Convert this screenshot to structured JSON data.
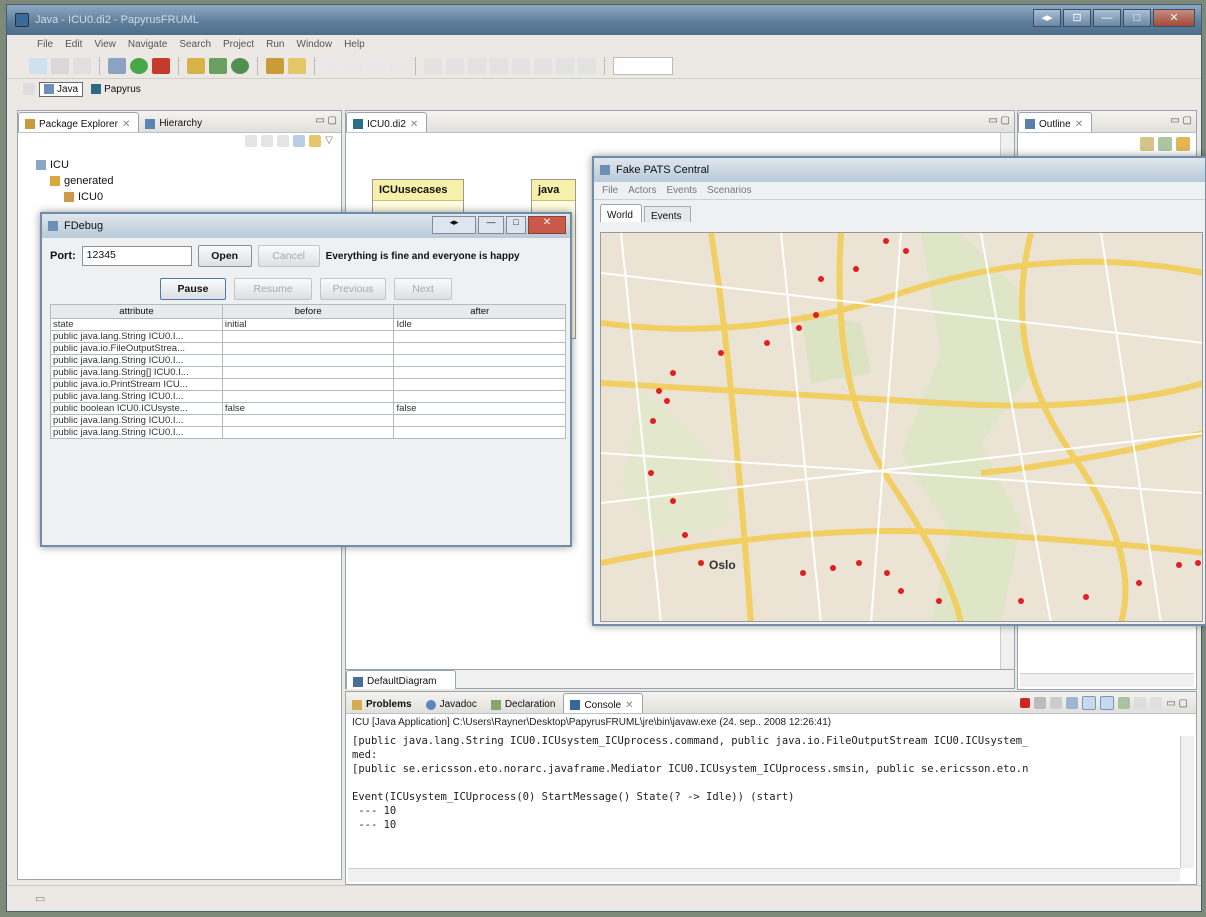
{
  "eclipse": {
    "window_title": "Java - ICU0.di2 - PapyrusFRUML",
    "menu": [
      "File",
      "Edit",
      "View",
      "Navigate",
      "Search",
      "Project",
      "Run",
      "Window",
      "Help"
    ],
    "perspectives": [
      "Java",
      "Papyrus"
    ]
  },
  "package_explorer": {
    "tabs": [
      "Package Explorer",
      "Hierarchy"
    ],
    "tree": [
      "ICU",
      "generated",
      "ICU0"
    ]
  },
  "editor": {
    "tab": "ICU0.di2",
    "boxes": [
      "ICUusecases",
      "java"
    ],
    "diagram_tab": "DefaultDiagram"
  },
  "outline": {
    "tab": "Outline"
  },
  "console": {
    "tabs": [
      "Problems",
      "Javadoc",
      "Declaration",
      "Console"
    ],
    "header": "ICU [Java Application] C:\\Users\\Rayner\\Desktop\\PapyrusFRUML\\jre\\bin\\javaw.exe (24. sep.. 2008 12:26:41)",
    "lines": [
      "[public java.lang.String ICU0.ICUsystem_ICUprocess.command, public java.io.FileOutputStream ICU0.ICUsystem_",
      "med:",
      "[public se.ericsson.eto.norarc.javaframe.Mediator ICU0.ICUsystem_ICUprocess.smsin, public se.ericsson.eto.n",
      "",
      "Event(ICUsystem_ICUprocess(0) StartMessage() State(? -> Idle)) (start)",
      " --- 10",
      " --- 10"
    ]
  },
  "fdebug": {
    "title": "FDebug",
    "port_label": "Port:",
    "port_value": "12345",
    "open": "Open",
    "cancel": "Cancel",
    "status": "Everything is fine and everyone is happy",
    "pause": "Pause",
    "resume": "Resume",
    "previous": "Previous",
    "next": "Next",
    "columns": [
      "attribute",
      "before",
      "after"
    ],
    "rows": [
      [
        "state",
        "initial",
        "Idle"
      ],
      [
        "public java.lang.String ICU0.I...",
        "",
        ""
      ],
      [
        "public java.io.FileOutputStrea...",
        "",
        ""
      ],
      [
        "public java.lang.String ICU0.I...",
        "",
        ""
      ],
      [
        "public java.lang.String[] ICU0.I...",
        "",
        ""
      ],
      [
        "public java.io.PrintStream ICU...",
        "",
        ""
      ],
      [
        "public java.lang.String ICU0.I...",
        "",
        ""
      ],
      [
        "public boolean ICU0.ICUsyste...",
        "false",
        "false"
      ],
      [
        "public java.lang.String ICU0.I...",
        "",
        ""
      ],
      [
        "public java.lang.String ICU0.I...",
        "",
        ""
      ]
    ]
  },
  "pats": {
    "title": "Fake PATS Central",
    "menu": [
      "File",
      "Actors",
      "Events",
      "Scenarios"
    ],
    "tabs": [
      "World",
      "Events"
    ],
    "city_label": "Oslo"
  }
}
